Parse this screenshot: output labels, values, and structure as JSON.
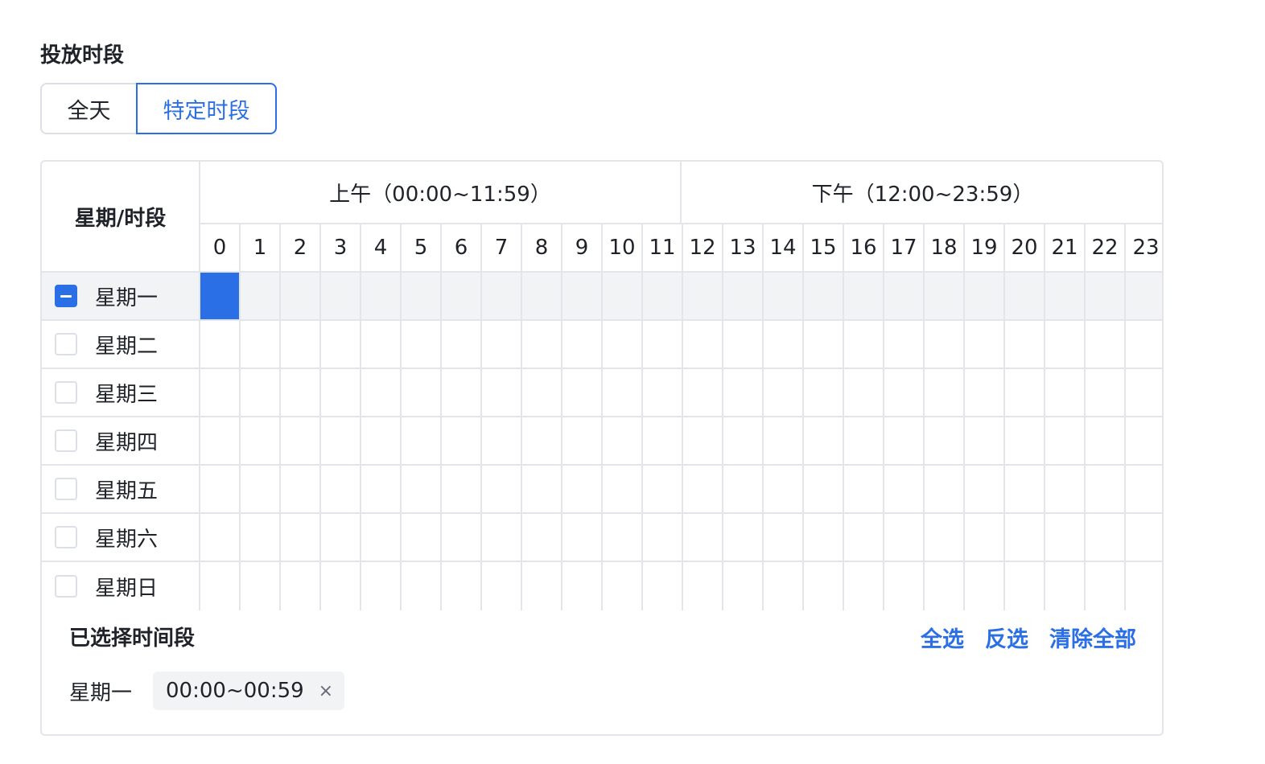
{
  "section_title": "投放时段",
  "mode_toggle": {
    "all_day": "全天",
    "specific": "特定时段",
    "active": "specific"
  },
  "schedule": {
    "corner_label": "星期/时段",
    "am_label": "上午（00:00~11:59）",
    "pm_label": "下午（12:00~23:59）",
    "hours": [
      "0",
      "1",
      "2",
      "3",
      "4",
      "5",
      "6",
      "7",
      "8",
      "9",
      "10",
      "11",
      "12",
      "13",
      "14",
      "15",
      "16",
      "17",
      "18",
      "19",
      "20",
      "21",
      "22",
      "23"
    ],
    "days": [
      {
        "label": "星期一",
        "state": "partial",
        "selected_hours": [
          0
        ]
      },
      {
        "label": "星期二",
        "state": "unchecked",
        "selected_hours": []
      },
      {
        "label": "星期三",
        "state": "unchecked",
        "selected_hours": []
      },
      {
        "label": "星期四",
        "state": "unchecked",
        "selected_hours": []
      },
      {
        "label": "星期五",
        "state": "unchecked",
        "selected_hours": []
      },
      {
        "label": "星期六",
        "state": "unchecked",
        "selected_hours": []
      },
      {
        "label": "星期日",
        "state": "unchecked",
        "selected_hours": []
      }
    ]
  },
  "footer": {
    "title": "已选择时间段",
    "select_all": "全选",
    "invert": "反选",
    "clear_all": "清除全部",
    "selections": [
      {
        "day": "星期一",
        "range": "00:00~00:59",
        "close": "×"
      }
    ]
  },
  "colors": {
    "accent": "#2b6fe6",
    "row_active": "#f2f3f5",
    "border": "#e3e5ea"
  }
}
